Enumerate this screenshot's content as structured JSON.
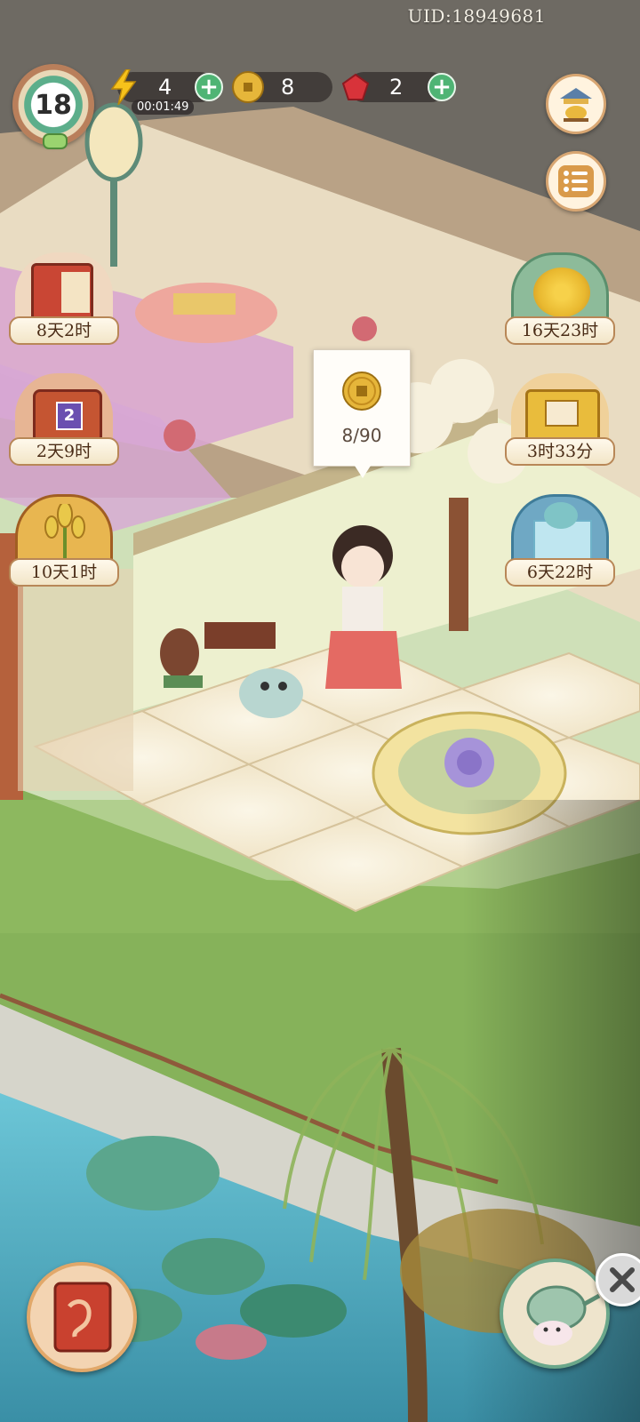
{
  "header": {
    "uid": "UID:18949681",
    "level": "18",
    "energy_value": "4",
    "energy_timer": "00:01:49",
    "coins_value": "8",
    "gems_value": "2",
    "plus_glyph": "+"
  },
  "events_left": [
    {
      "label": "8天2时",
      "icon": "book-event-icon"
    },
    {
      "label": "2天9时",
      "icon": "gift-box-event-icon",
      "badge": "2"
    },
    {
      "label": "10天1时",
      "icon": "wheat-event-icon"
    }
  ],
  "events_right": [
    {
      "label": "16天23时",
      "icon": "chrysanthemum-event-icon"
    },
    {
      "label": "3时33分",
      "icon": "treasure-chest-event-icon"
    },
    {
      "label": "6天22时",
      "icon": "cat-giftbox-event-icon"
    }
  ],
  "tooltip": {
    "progress_text": "8/90",
    "icon": "coin-icon"
  },
  "colors": {
    "energy": "#f6c21b",
    "coin": "#e6b63a",
    "gem": "#d8333a",
    "plus": "#4fb474"
  }
}
